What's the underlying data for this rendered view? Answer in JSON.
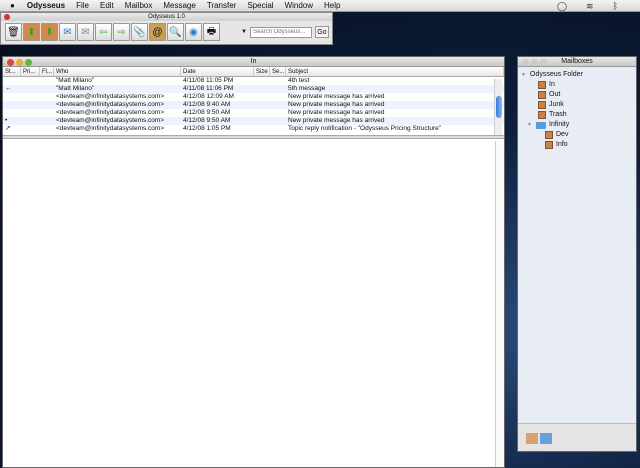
{
  "menubar": {
    "apple": "",
    "items": [
      "Odysseus",
      "File",
      "Edit",
      "Mailbox",
      "Message",
      "Transfer",
      "Special",
      "Window",
      "Help"
    ]
  },
  "toolbar": {
    "title": "Odysseus 1.0",
    "tools": [
      "trash-icon",
      "get-mail-icon",
      "send-mail-icon",
      "reply-all-icon",
      "new-message-icon",
      "reply-icon",
      "forward-icon",
      "attachment-icon",
      "address-book-icon",
      "find-icon",
      "search-icon",
      "print-icon"
    ],
    "search_placeholder": "Search Odysseus...",
    "go_label": "Go",
    "scope_arrow": "▼"
  },
  "inbox": {
    "title": "In",
    "columns": [
      "St...",
      "Pri...",
      "Fl...",
      "Who",
      "Date",
      "Size",
      "Se...",
      "Subject"
    ],
    "rows": [
      {
        "status": "",
        "who": "\"Matt Milano\"",
        "date": "4/11/08 11:05 PM",
        "subject": "4th test"
      },
      {
        "status": "←",
        "who": "\"Matt Milano\"",
        "date": "4/11/08 11:06 PM",
        "subject": "5th message"
      },
      {
        "status": "",
        "who": "<devteam@infinitydatasystems.com>",
        "date": "4/12/08 12:09 AM",
        "subject": "New private message has arrived"
      },
      {
        "status": "",
        "who": "<devteam@infinitydatasystems.com>",
        "date": "4/12/08 9:40 AM",
        "subject": "New private message has arrived"
      },
      {
        "status": "",
        "who": "<devteam@infinitydatasystems.com>",
        "date": "4/12/08 9:50 AM",
        "subject": "New private message has arrived"
      },
      {
        "status": "•",
        "who": "<devteam@infinitydatasystems.com>",
        "date": "4/12/08 9:50 AM",
        "subject": "New private message has arrived"
      },
      {
        "status": "↗",
        "who": "<devteam@infinitydatasystems.com>",
        "date": "4/12/08 1:05 PM",
        "subject": "Topic reply notification - \"Odysseus Pricing Structure\""
      }
    ]
  },
  "mailboxes": {
    "title": "Mailboxes",
    "root": "Odysseus Folder",
    "items": [
      "In",
      "Out",
      "Junk",
      "Trash"
    ],
    "folder": "Infinity",
    "subitems": [
      "Dev",
      "Info"
    ]
  }
}
